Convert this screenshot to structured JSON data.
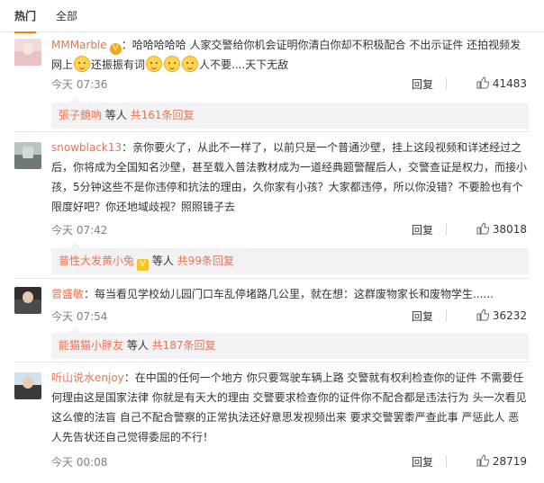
{
  "tabs": {
    "hot": "热门",
    "all": "全部"
  },
  "comments": [
    {
      "user": "MMMarble",
      "text_a": "：哈哈哈哈哈 人家交警给你机会证明你清白你却不积极配合 不出示证件 还拍视频发网上",
      "text_b": "还振振有词",
      "text_c": "人不要....天下无敌",
      "time": "今天 07:36",
      "reply": "回复",
      "likes": "41483",
      "sub_user": "張子鏡吶",
      "sub_text": " 等人 ",
      "sub_count": "共161条回复"
    },
    {
      "user": "snowblack13",
      "text": "：亲你要火了，从此不一样了，以前只是一个普通沙壁，挂上这段视频和详述经过之后，你将成为全国知名沙壁，甚至载入普法教材成为一道经典题警醒后人，交警查证是权力，而接小孩，5分钟这些不是你违停和抗法的理由，久你家有小孩？大家都违停，所以你没错？不要脸也有个限度好吧？你还地域歧视？照照镜子去",
      "time": "今天 07:42",
      "reply": "回复",
      "likes": "38018",
      "sub_user": "普性大发黄小兔",
      "sub_text": " 等人 ",
      "sub_count": "共99条回复"
    },
    {
      "user": "曾盛敏",
      "text": "：每当看见学校幼儿园门口车乱停堵路几公里，就在想：这群废物家长和废物学生......",
      "time": "今天 07:54",
      "reply": "回复",
      "likes": "36232",
      "sub_user": "能猫猫小胖友",
      "sub_text": " 等人 ",
      "sub_count": "共187条回复"
    },
    {
      "user": "听山说水enjoy",
      "text": "：在中国的任何一个地方 你只要驾驶车辆上路 交警就有权利检查你的证件 不需要任何理由这是国家法律 你就是有天大的理由 交警要求检查你的证件你不配合都是违法行为 头一次看见这么傻的法盲 自己不配合警察的正常执法还好意思发视频出来 要求交警罢黍严查此事 严惩此人 恶人先告状还自己觉得委屈的不行！",
      "time": "今天 00:08",
      "reply": "回复",
      "likes": "28719"
    }
  ],
  "colors": {
    "accent": "#eb7350",
    "tab_underline": "#ff8200",
    "subreply_bg": "#f2f2f5"
  }
}
